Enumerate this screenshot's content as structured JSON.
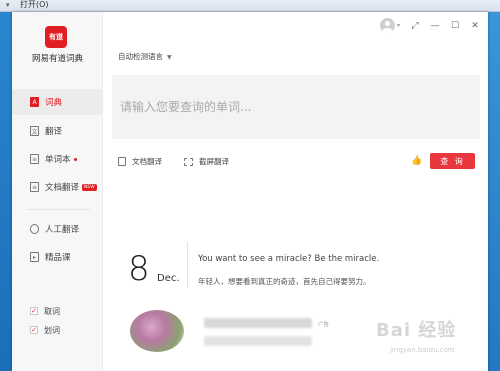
{
  "system": {
    "menu_label": "打开(O)"
  },
  "sidebar": {
    "logo_text": "有道",
    "app_name": "网易有道词典",
    "items": [
      {
        "label": "词典",
        "icon": "dictionary-icon"
      },
      {
        "label": "翻译",
        "icon": "translate-icon"
      },
      {
        "label": "单词本",
        "icon": "wordbook-icon"
      },
      {
        "label": "文档翻译",
        "icon": "document-translate-icon",
        "badge": "NEW"
      },
      {
        "label": "人工翻译",
        "icon": "human-translate-icon"
      },
      {
        "label": "精品课",
        "icon": "course-icon"
      }
    ],
    "checks": [
      {
        "label": "取词",
        "checked": true
      },
      {
        "label": "划词",
        "checked": true
      }
    ]
  },
  "main": {
    "language_select": "自动检测语言",
    "search_placeholder": "请输入您要查询的单词...",
    "tools": {
      "doc_translate": "文档翻译",
      "screenshot_translate": "截屏翻译"
    },
    "query_button": "查 询",
    "daily": {
      "day": "8",
      "month": "Dec.",
      "quote_en": "You want to see a miracle? Be the miracle.",
      "quote_zh": "年轻人，想要看到真正的奇迹，首先自己得要努力。"
    },
    "ad_label": "广告"
  },
  "watermark": {
    "logo": "Bai 经验",
    "url": "jingyan.baidu.com"
  },
  "colors": {
    "accent": "#e21e25",
    "button": "#e8373d",
    "sidebar_bg": "#f7f7f7",
    "desktop": "#1f7fc9"
  }
}
